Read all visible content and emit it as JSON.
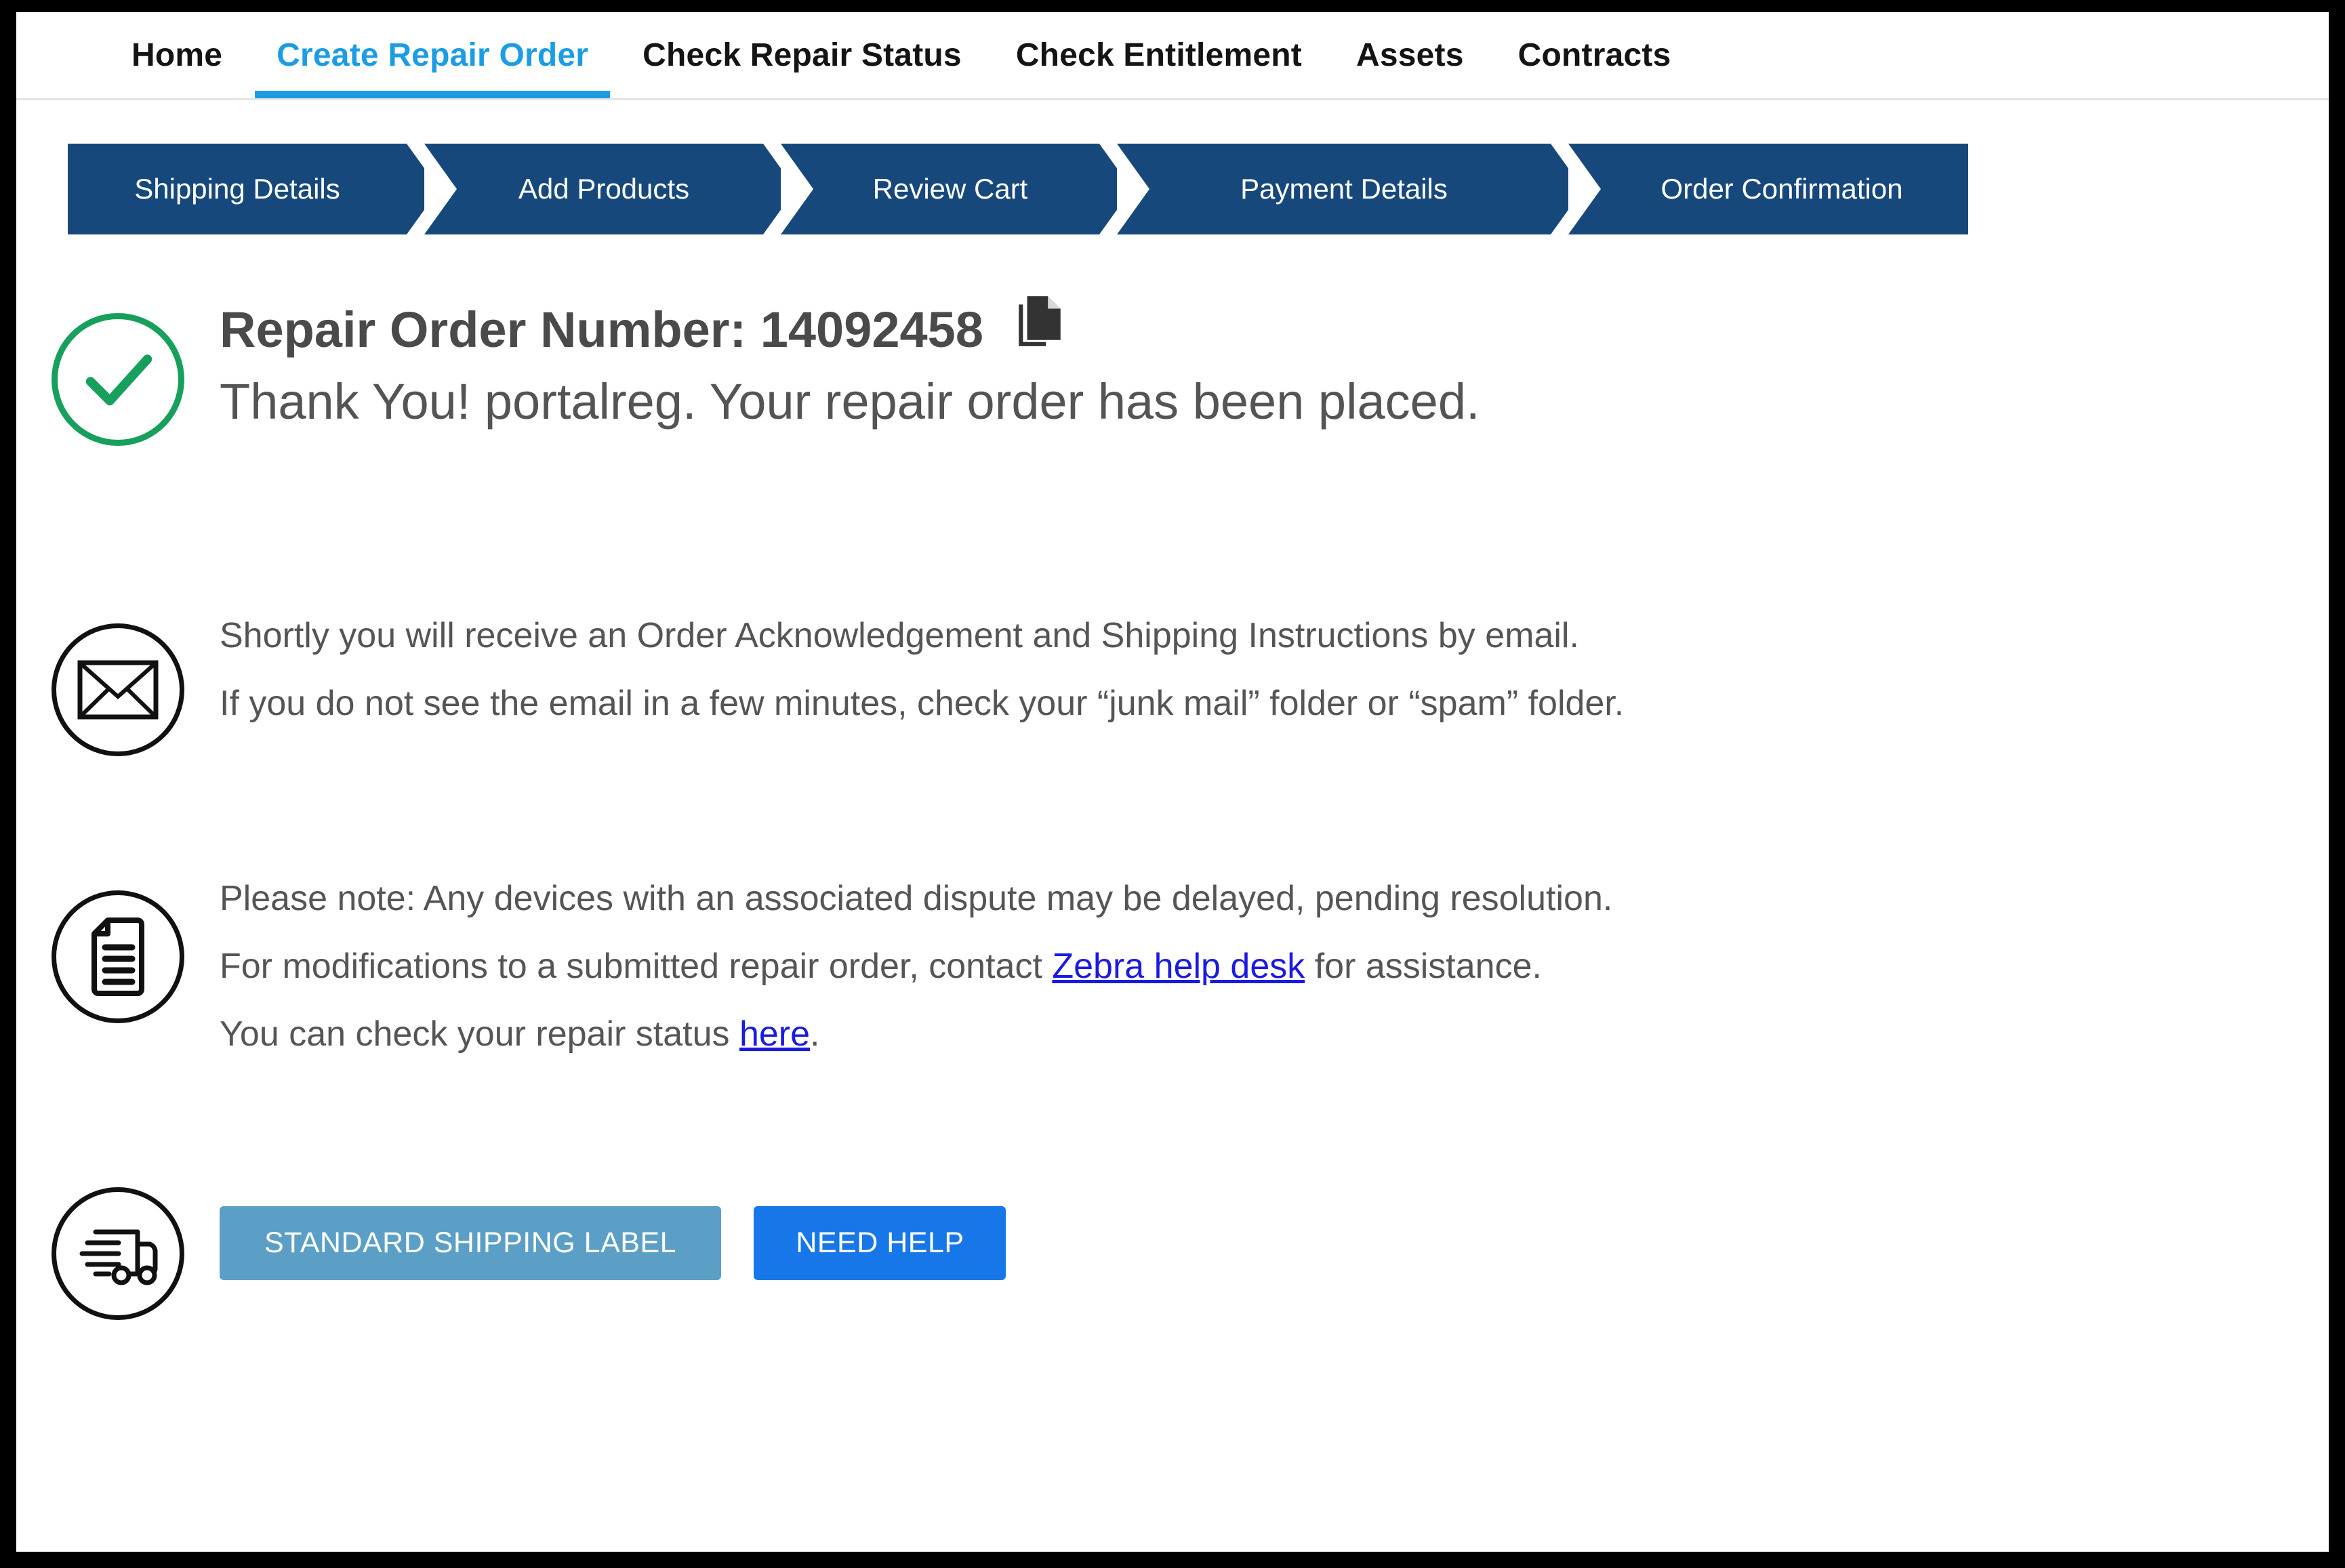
{
  "topnav": {
    "items": [
      {
        "label": "Home",
        "active": false
      },
      {
        "label": "Create Repair Order",
        "active": true
      },
      {
        "label": "Check Repair Status",
        "active": false
      },
      {
        "label": "Check Entitlement",
        "active": false
      },
      {
        "label": "Assets",
        "active": false
      },
      {
        "label": "Contracts",
        "active": false
      }
    ],
    "active_color": "#1b9ce5",
    "text_color": "#141414"
  },
  "steps": {
    "color": "#17487c",
    "items": [
      {
        "label": "Shipping Details"
      },
      {
        "label": "Add Products"
      },
      {
        "label": "Review Cart"
      },
      {
        "label": "Payment Details"
      },
      {
        "label": "Order Confirmation"
      }
    ]
  },
  "confirmation": {
    "status_icon": "check-circle-icon",
    "status_color": "#17a05c",
    "order_number_label": "Repair Order Number: 14092458",
    "order_number": "14092458",
    "thank_you": "Thank You! portalreg. Your repair order has been placed.",
    "copy_icon": "copy-document-icon"
  },
  "email_notice": {
    "icon": "envelope-icon",
    "line1": "Shortly you will receive an Order Acknowledgement and Shipping Instructions by email.",
    "line2": "If you do not see the email in a few minutes, check your “junk mail” folder or “spam” folder."
  },
  "note": {
    "icon": "document-lines-icon",
    "line1": "Please note: Any devices with an associated dispute may be delayed, pending resolution.",
    "line2_before": "For modifications to a submitted repair order, contact",
    "line2_link": " Zebra help desk",
    "line2_after": " for assistance.",
    "line3_before": "You can check your repair status ",
    "line3_link": "here",
    "line3_after": ".",
    "link_color": "#1a1ae0"
  },
  "actions": {
    "icon": "delivery-truck-icon",
    "shipping_label_button": "STANDARD SHIPPING LABEL",
    "shipping_label_color": "#5b9fc6",
    "need_help_button": "NEED HELP",
    "need_help_color": "#1877e8"
  }
}
